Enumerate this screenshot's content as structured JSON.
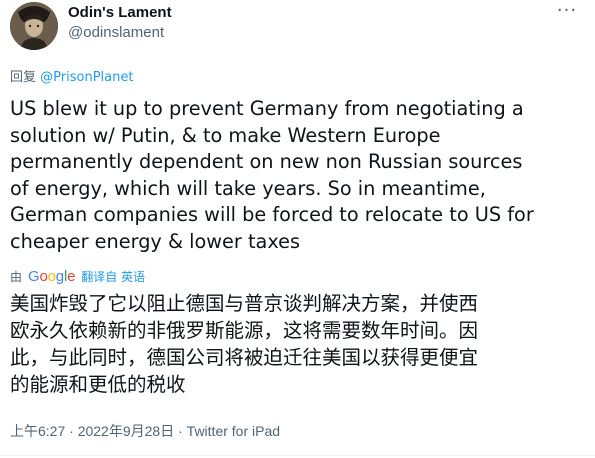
{
  "author": {
    "name": "Odin's Lament",
    "handle": "@odinslament",
    "avatar_icon": "profile-photo"
  },
  "more_icon_glyph": "···",
  "reply": {
    "prefix": "回复",
    "mention": "@PrisonPlanet"
  },
  "tweet": {
    "text_lines": [
      "US blew it up to prevent Germany from negotiating a",
      "solution w/ Putin, & to make Western Europe",
      "permanently dependent on new non Russian sources",
      "of energy, which will take years. So in meantime,",
      "German companies will be forced to relocate to US for",
      "cheaper energy & lower taxes"
    ],
    "translated_lines": [
      "美国炸毁了它以阻止德国与普京谈判解决方案，并使西",
      "欧永久依赖新的非俄罗斯能源，这将需要数年时间。因",
      "此，与此同时，德国公司将被迫迁往美国以获得更便宜",
      "的能源和更低的税收"
    ]
  },
  "translation": {
    "by": "由",
    "google": [
      "G",
      "o",
      "o",
      "g",
      "l",
      "e"
    ],
    "google_colors": [
      "#4285f4",
      "#ea4335",
      "#fbbc05",
      "#4285f4",
      "#34a853",
      "#ea4335"
    ],
    "label": "翻译自 英语"
  },
  "meta": {
    "time": "上午6:27",
    "sep1": " · ",
    "date": "2022年9月28日",
    "sep2": " · ",
    "source": "Twitter for iPad"
  },
  "colors": {
    "link": "#1d9bf0",
    "secondary_text": "#536471",
    "primary_text": "#0f1419"
  }
}
